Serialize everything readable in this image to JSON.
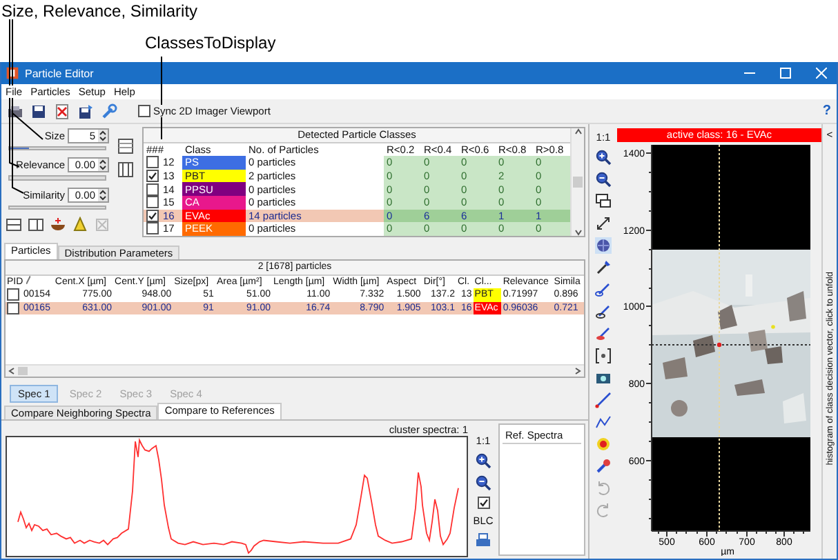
{
  "annotations": [
    {
      "text": "Size, Relevance, Similarity"
    },
    {
      "text": "ClassesToDisplay"
    }
  ],
  "window": {
    "title": "Particle Editor"
  },
  "menu": [
    "File",
    "Particles",
    "Setup",
    "Help"
  ],
  "toolbar": {
    "sync": {
      "label": "Sync 2D Imager Viewport",
      "checked": false
    },
    "help": "?"
  },
  "filters": [
    {
      "label": "Size",
      "value": "5",
      "level": 0.2
    },
    {
      "label": "Relevance",
      "value": "0.00",
      "level": 0
    },
    {
      "label": "Similarity",
      "value": "0.00",
      "level": 0
    }
  ],
  "classes": {
    "title": "Detected Particle Classes",
    "columns": [
      "###",
      "Class",
      "No. of Particles",
      "R<0.2",
      "R<0.4",
      "R<0.6",
      "R<0.8",
      "R>0.8"
    ],
    "rows": [
      {
        "id": "12",
        "name": "PS",
        "color": "#3d6ee3",
        "count": "0 particles",
        "bins": [
          "0",
          "0",
          "0",
          "0",
          "0"
        ],
        "checked": false,
        "selected": false
      },
      {
        "id": "13",
        "name": "PBT",
        "color": "#ffff00",
        "count": "2 particles",
        "bins": [
          "0",
          "0",
          "0",
          "2",
          "0"
        ],
        "checked": true,
        "selected": false
      },
      {
        "id": "14",
        "name": "PPSU",
        "color": "#800080",
        "count": "0 particles",
        "bins": [
          "0",
          "0",
          "0",
          "0",
          "0"
        ],
        "checked": false,
        "selected": false
      },
      {
        "id": "15",
        "name": "CA",
        "color": "#e8188c",
        "count": "0 particles",
        "bins": [
          "0",
          "0",
          "0",
          "0",
          "0"
        ],
        "checked": false,
        "selected": false
      },
      {
        "id": "16",
        "name": "EVAc",
        "color": "#ff0000",
        "count": "14 particles",
        "bins": [
          "0",
          "6",
          "6",
          "1",
          "1"
        ],
        "checked": true,
        "selected": true
      },
      {
        "id": "17",
        "name": "PEEK",
        "color": "#ff6a00",
        "count": "0 particles",
        "bins": [
          "0",
          "0",
          "0",
          "0",
          "0"
        ],
        "checked": false,
        "selected": false
      }
    ]
  },
  "particles": {
    "tabs": [
      {
        "label": "Particles",
        "selected": true
      },
      {
        "label": "Distribution Parameters",
        "selected": false
      }
    ],
    "summary": "2 [1678] particles",
    "columns": [
      "PID",
      "Cent.X [µm]",
      "Cent.Y [µm]",
      "Size[px]",
      "Area [µm²]",
      "Length [µm]",
      "Width [µm]",
      "Aspect",
      "Dir[°]",
      "Cl.",
      "Cl...",
      "Relevance",
      "Simila"
    ],
    "rows": [
      {
        "checked": false,
        "selected": false,
        "cells": [
          "00154",
          "775.00",
          "948.00",
          "51",
          "51.00",
          "11.00",
          "7.332",
          "1.500",
          "137.2",
          "13",
          "PBT",
          "0.71997",
          "0.896"
        ],
        "color": "#ffff00"
      },
      {
        "checked": false,
        "selected": true,
        "cells": [
          "00165",
          "631.00",
          "901.00",
          "91",
          "91.00",
          "16.74",
          "8.790",
          "1.905",
          "103.1",
          "16",
          "EVAc",
          "0.96036",
          "0.721"
        ],
        "color": "#ff0000"
      }
    ]
  },
  "spectra": {
    "spec_tabs": [
      {
        "label": "Spec 1",
        "selected": true,
        "disabled": false
      },
      {
        "label": "Spec 2",
        "selected": false,
        "disabled": true
      },
      {
        "label": "Spec 3",
        "selected": false,
        "disabled": true
      },
      {
        "label": "Spec 4",
        "selected": false,
        "disabled": true
      }
    ],
    "view_tabs": [
      {
        "label": "Compare Neighboring Spectra",
        "selected": false
      },
      {
        "label": "Compare to References",
        "selected": true
      }
    ],
    "cluster_label": "cluster spectra: 1",
    "scale": "1:1",
    "blc": {
      "label": "BLC",
      "checked": true
    },
    "ref_title": "Ref. Spectra"
  },
  "image_view": {
    "scale": "1:1",
    "active_class": "active class: 16 - EVAc",
    "yticks": [
      "1400",
      "1200",
      "1000",
      "800",
      "600"
    ],
    "xticks": [
      "500",
      "600",
      "700",
      "800"
    ],
    "xlabel": "µm",
    "side_text": "histogram of class decision vector, click to unfold",
    "collapse": "<"
  }
}
